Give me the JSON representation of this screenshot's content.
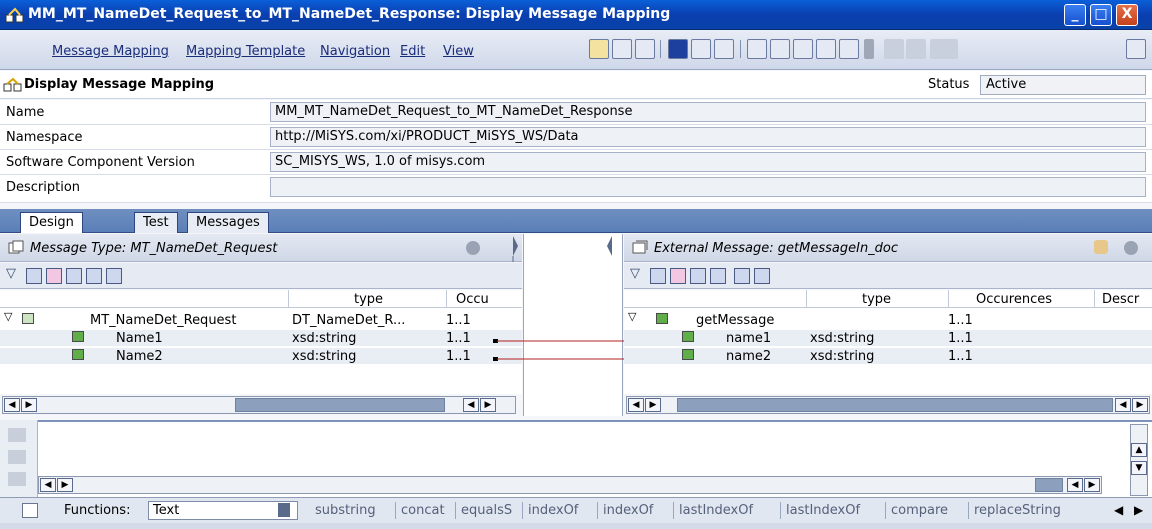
{
  "window": {
    "title": "MM_MT_NameDet_Request_to_MT_NameDet_Response: Display Message Mapping",
    "buttons": {
      "minimize": "_",
      "maximize": "□",
      "close": "X"
    }
  },
  "menu": {
    "items": [
      "Message Mapping",
      "Mapping Template",
      "Navigation",
      "Edit",
      "View"
    ]
  },
  "header": {
    "title": "Display Message Mapping",
    "status_label": "Status",
    "status_value": "Active"
  },
  "fields": [
    {
      "label": "Name",
      "value": "MM_MT_NameDet_Request_to_MT_NameDet_Response"
    },
    {
      "label": "Namespace",
      "value": "http://MiSYS.com/xi/PRODUCT_MiSYS_WS/Data"
    },
    {
      "label": "Software Component Version",
      "value": "SC_MISYS_WS, 1.0 of misys.com"
    },
    {
      "label": "Description",
      "value": ""
    }
  ],
  "tabs": [
    "Design",
    "Test",
    "Messages"
  ],
  "source": {
    "title": "Message Type: MT_NameDet_Request",
    "columns": [
      "type",
      "Occu"
    ],
    "rows": [
      {
        "name": "MT_NameDet_Request",
        "type": "DT_NameDet_R...",
        "occ": "1..1"
      },
      {
        "name": "Name1",
        "type": "xsd:string",
        "occ": "1..1"
      },
      {
        "name": "Name2",
        "type": "xsd:string",
        "occ": "1..1"
      }
    ]
  },
  "target": {
    "title": "External Message: getMessageIn_doc",
    "columns": [
      "type",
      "Occurences",
      "Descr"
    ],
    "rows": [
      {
        "name": "getMessage",
        "type": "",
        "occ": "1..1"
      },
      {
        "name": "name1",
        "type": "xsd:string",
        "occ": "1..1"
      },
      {
        "name": "name2",
        "type": "xsd:string",
        "occ": "1..1"
      }
    ]
  },
  "functions": {
    "label": "Functions:",
    "selected": "Text",
    "items": [
      "substring",
      "concat",
      "equalsS",
      "indexOf",
      "indexOf",
      "lastIndexOf",
      "lastIndexOf",
      "compare",
      "replaceString"
    ]
  },
  "colors": {
    "titlebar": "#0a4fc8",
    "mapping_line": "#b02020",
    "node_green": "#5fae4a"
  }
}
